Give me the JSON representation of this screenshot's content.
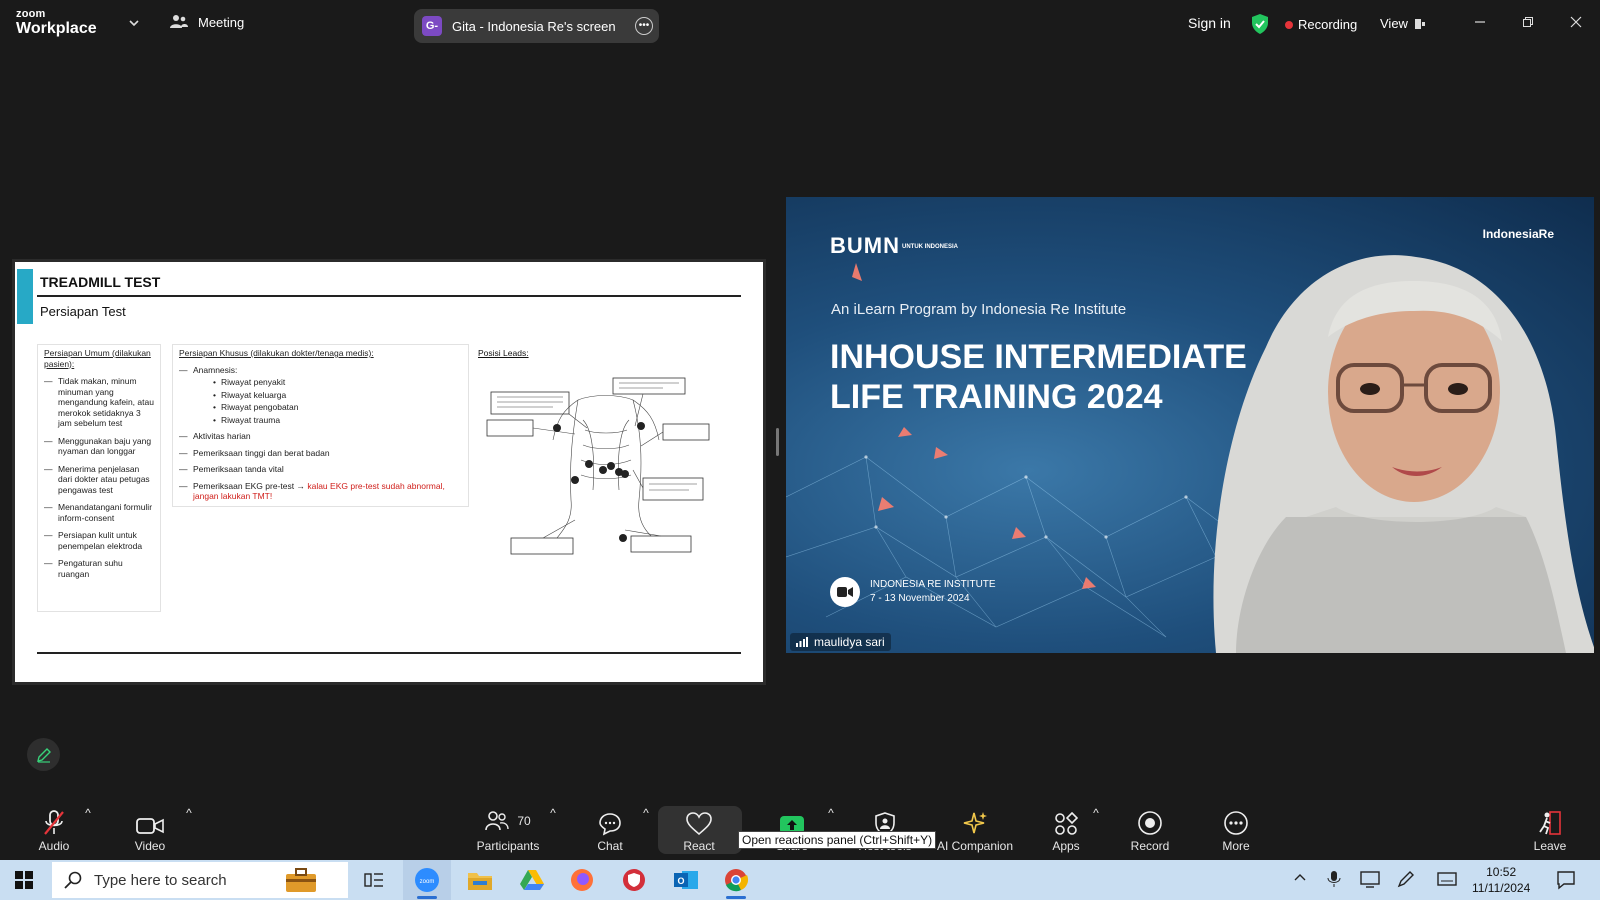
{
  "titlebar": {
    "logo_line1": "zoom",
    "logo_line2": "Workplace",
    "meeting_label": "Meeting",
    "share_initial": "G-",
    "share_title": "Gita - Indonesia Re's screen",
    "sign_in": "Sign in",
    "recording": "Recording",
    "view": "View"
  },
  "slide": {
    "title": "TREADMILL TEST",
    "subtitle": "Persiapan Test",
    "general_heading": "Persiapan Umum (dilakukan pasien):",
    "general_items": [
      "Tidak makan, minum minuman yang mengandung kafein, atau merokok setidaknya 3 jam sebelum test",
      "Menggunakan baju yang nyaman dan longgar",
      "Menerima penjelasan dari dokter atau petugas pengawas test",
      "Menandatangani formulir inform-consent",
      "Persiapan kulit untuk penempelan elektroda",
      "Pengaturan suhu ruangan"
    ],
    "special_heading": "Persiapan Khusus (dilakukan dokter/tenaga medis):",
    "anamnesis": "Anamnesis:",
    "anamnesis_items": [
      "Riwayat penyakit",
      "Riwayat keluarga",
      "Riwayat pengobatan",
      "Riwayat trauma"
    ],
    "activity": "Aktivitas harian",
    "height_weight": "Pemeriksaan tinggi dan berat badan",
    "vitals": "Pemeriksaan tanda vital",
    "ekg_prefix": "Pemeriksaan EKG pre-test →",
    "ekg_warning": "kalau EKG pre-test sudah abnormal, jangan lakukan TMT!",
    "leads_label": "Posisi Leads:"
  },
  "video": {
    "bumn": "BUMN",
    "bumn_small": "UNTUK INDONESIA",
    "ire_logo": "IndonesiaRe",
    "program": "An iLearn Program by Indonesia Re Institute",
    "headline_1": "INHOUSE INTERMEDIATE",
    "headline_2": "LIFE TRAINING 2024",
    "footer_org": "INDONESIA RE INSTITUTE",
    "footer_dates": "7 - 13 November 2024",
    "participant_name": "maulidya sari"
  },
  "toolbar": {
    "audio": "Audio",
    "video": "Video",
    "participants": "Participants",
    "participant_count": "70",
    "chat": "Chat",
    "react": "React",
    "share": "Share",
    "host_tools": "Host tools",
    "ai_companion": "AI Companion",
    "apps": "Apps",
    "record": "Record",
    "more": "More",
    "leave": "Leave",
    "tooltip": "Open reactions panel (Ctrl+Shift+Y)"
  },
  "taskbar": {
    "search_placeholder": "Type here to search",
    "time": "10:52",
    "date": "11/11/2024"
  },
  "colors": {
    "accent_bar": "#27a9c6",
    "recording_dot": "#e5343a",
    "share_green": "#22c55e",
    "warning_red": "#d0201c"
  }
}
